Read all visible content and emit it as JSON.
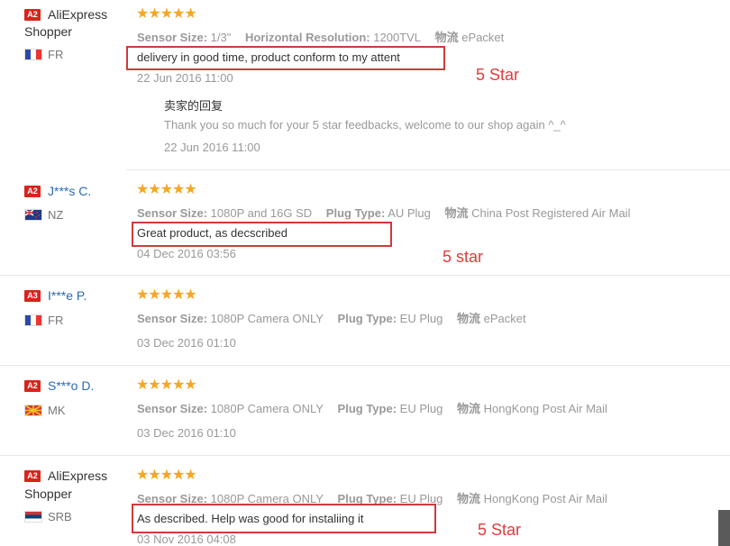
{
  "reviews": [
    {
      "badge": "A2",
      "name_line1": "AliExpress",
      "name_line2": "Shopper",
      "country": "FR",
      "flag": "france",
      "stars": "★★★★★",
      "attrs": [
        {
          "label": "Sensor Size:",
          "value": "1/3\""
        },
        {
          "label": "Horizontal Resolution:",
          "value": "1200TVL"
        },
        {
          "label": "物流",
          "value": "ePacket"
        }
      ],
      "feedback": "delivery in good time, product conform to my attent",
      "date": "22 Jun 2016 11:00",
      "annotation": "5 Star",
      "reply": {
        "title": "卖家的回复",
        "text": "Thank you so much for your 5 star feedbacks, welcome to our shop again ^_^",
        "date": "22 Jun 2016 11:00"
      }
    },
    {
      "badge": "A2",
      "name": "J***s C.",
      "country": "NZ",
      "flag": "new-zealand",
      "stars": "★★★★★",
      "attrs": [
        {
          "label": "Sensor Size:",
          "value": "1080P and 16G SD"
        },
        {
          "label": "Plug Type:",
          "value": "AU Plug"
        },
        {
          "label": "物流",
          "value": "China Post Registered Air Mail"
        }
      ],
      "feedback": "Great product, as decscribed",
      "date": "04 Dec 2016 03:56",
      "annotation": "5 star"
    },
    {
      "badge": "A3",
      "name": "I***e P.",
      "country": "FR",
      "flag": "france",
      "stars": "★★★★★",
      "attrs": [
        {
          "label": "Sensor Size:",
          "value": "1080P Camera ONLY"
        },
        {
          "label": "Plug Type:",
          "value": "EU Plug"
        },
        {
          "label": "物流",
          "value": "ePacket"
        }
      ],
      "date": "03 Dec 2016 01:10"
    },
    {
      "badge": "A2",
      "name": "S***o D.",
      "country": "MK",
      "flag": "macedonia",
      "stars": "★★★★★",
      "attrs": [
        {
          "label": "Sensor Size:",
          "value": "1080P Camera ONLY"
        },
        {
          "label": "Plug Type:",
          "value": "EU Plug"
        },
        {
          "label": "物流",
          "value": "HongKong Post Air Mail"
        }
      ],
      "date": "03 Dec 2016 01:10"
    },
    {
      "badge": "A2",
      "name_line1": "AliExpress",
      "name_line2": "Shopper",
      "country": "SRB",
      "flag": "serbia",
      "stars": "★★★★★",
      "attrs": [
        {
          "label": "Sensor Size:",
          "value": "1080P Camera ONLY"
        },
        {
          "label": "Plug Type:",
          "value": "EU Plug"
        },
        {
          "label": "物流",
          "value": "HongKong Post Air Mail"
        }
      ],
      "feedback": "As described. Help was good for instaliing it",
      "date": "03 Nov 2016 04:08",
      "annotation": "5 Star"
    }
  ],
  "colors": {
    "badge": "#d9241b",
    "star": "#f5a623",
    "annotation": "#e23b3b",
    "link": "#2a6ab5"
  }
}
